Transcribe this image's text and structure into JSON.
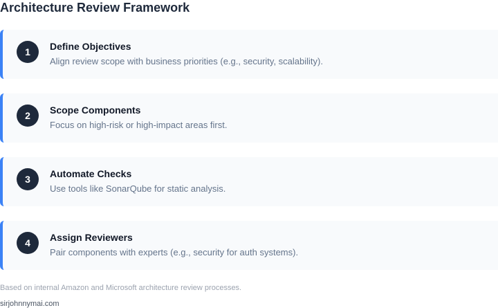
{
  "title": "Architecture Review Framework",
  "steps": [
    {
      "number": "1",
      "title": "Define Objectives",
      "description": "Align review scope with business priorities (e.g., security, scalability)."
    },
    {
      "number": "2",
      "title": "Scope Components",
      "description": "Focus on high-risk or high-impact areas first."
    },
    {
      "number": "3",
      "title": "Automate Checks",
      "description": "Use tools like SonarQube for static analysis."
    },
    {
      "number": "4",
      "title": "Assign Reviewers",
      "description": "Pair components with experts (e.g., security for auth systems)."
    }
  ],
  "footnote": "Based on internal Amazon and Microsoft architecture review processes.",
  "credit": "sirjohnnymai.com",
  "colors": {
    "accent": "#3b82f6",
    "badge": "#1e293b",
    "card": "#f8fafc"
  }
}
